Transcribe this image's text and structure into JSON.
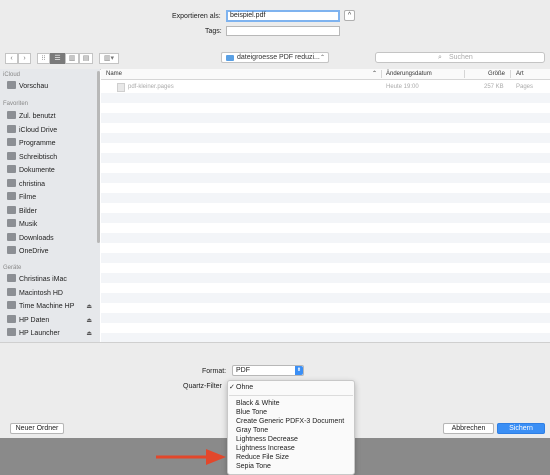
{
  "export": {
    "label": "Exportieren als:",
    "value": "beispiel.pdf",
    "toggle": "^"
  },
  "tags": {
    "label": "Tags:",
    "value": ""
  },
  "toolbar": {
    "back": "‹",
    "forward": "›",
    "view_icon": "⁝⁝",
    "view_list": "☰",
    "view_columns": "▥",
    "view_cover": "▤",
    "arrange": "▥▾",
    "path": "dateigroesse PDF reduzi...",
    "path_arrow": "⌃",
    "search_icon": "⌕",
    "search_placeholder": "Suchen"
  },
  "sidebar": {
    "sections": [
      {
        "title": "iCloud",
        "items": [
          {
            "label": "Vorschau",
            "icon": "preview-icon"
          }
        ]
      },
      {
        "title": "Favoriten",
        "items": [
          {
            "label": "Zul. benutzt",
            "icon": "recent-icon"
          },
          {
            "label": "iCloud Drive",
            "icon": "cloud-icon"
          },
          {
            "label": "Programme",
            "icon": "apps-icon"
          },
          {
            "label": "Schreibtisch",
            "icon": "desktop-icon"
          },
          {
            "label": "Dokumente",
            "icon": "documents-icon"
          },
          {
            "label": "christina",
            "icon": "home-icon"
          },
          {
            "label": "Filme",
            "icon": "movies-icon"
          },
          {
            "label": "Bilder",
            "icon": "pictures-icon"
          },
          {
            "label": "Musik",
            "icon": "music-icon"
          },
          {
            "label": "Downloads",
            "icon": "downloads-icon"
          },
          {
            "label": "OneDrive",
            "icon": "folder-icon"
          }
        ]
      },
      {
        "title": "Geräte",
        "items": [
          {
            "label": "Christinas iMac",
            "icon": "computer-icon",
            "eject": ""
          },
          {
            "label": "Macintosh HD",
            "icon": "disk-icon",
            "eject": ""
          },
          {
            "label": "Time Machine HP",
            "icon": "disk-icon",
            "eject": "⏏"
          },
          {
            "label": "HP Daten",
            "icon": "disk-icon",
            "eject": "⏏"
          },
          {
            "label": "HP Launcher",
            "icon": "disk-icon",
            "eject": "⏏"
          }
        ]
      }
    ]
  },
  "columns": {
    "name": "Name",
    "date": "Änderungsdatum",
    "size": "Größe",
    "kind": "Art",
    "sort_arrow": "⌃"
  },
  "files": [
    {
      "name": "pdf-kleiner.pages",
      "date": "Heute 19:00",
      "size": "257 KB",
      "kind": "Pages"
    }
  ],
  "format": {
    "label": "Format:",
    "value": "PDF",
    "stepper": "⬍"
  },
  "quartz": {
    "label": "Quartz-Filter"
  },
  "menu": {
    "selected": "Ohne",
    "check": "✓",
    "items": [
      "Black & White",
      "Blue Tone",
      "Create Generic PDFX-3 Document",
      "Gray Tone",
      "Lightness Decrease",
      "Lightness Increase",
      "Reduce File Size",
      "Sepia Tone"
    ]
  },
  "buttons": {
    "new_folder": "Neuer Ordner",
    "cancel": "Abbrechen",
    "save": "Sichern"
  },
  "colors": {
    "accent": "#3b8ff5",
    "annotation_arrow": "#e2472b"
  }
}
